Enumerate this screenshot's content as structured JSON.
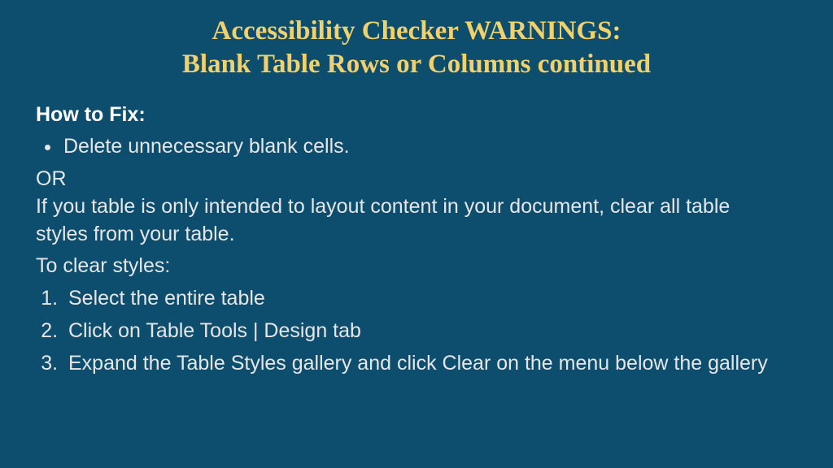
{
  "title_line1": "Accessibility Checker WARNINGS:",
  "title_line2": "Blank Table Rows or Columns continued",
  "howfix_label": "How to Fix:",
  "bullets": [
    "Delete unnecessary blank cells."
  ],
  "or_text": "OR",
  "paragraph": "If you table is only intended to layout content in your document, clear all table styles from your table.",
  "toclear_label": "To clear styles:",
  "steps": [
    "Select the entire table",
    "Click on Table Tools | Design tab",
    "Expand the Table Styles gallery and click Clear on the menu below the gallery"
  ]
}
